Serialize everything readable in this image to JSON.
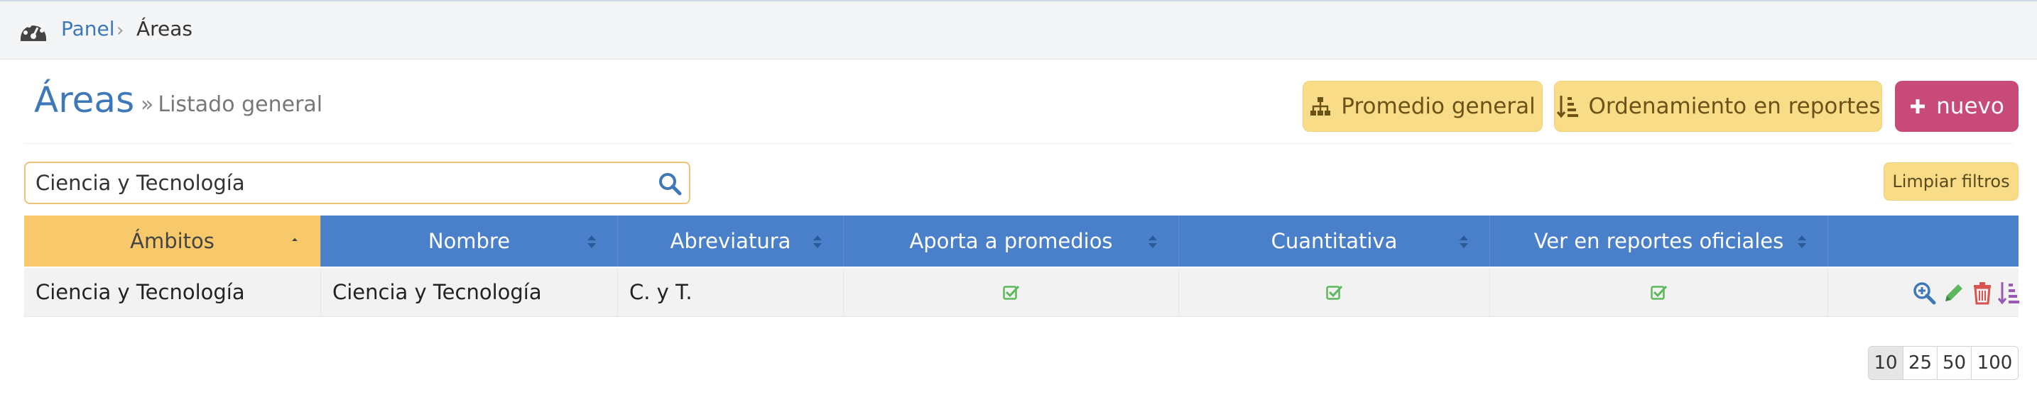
{
  "breadcrumb": {
    "root_label": "Panel",
    "separator": "›",
    "current": "Áreas"
  },
  "page": {
    "title": "Áreas",
    "subtitle_prefix": "»",
    "subtitle": "Listado general"
  },
  "toolbar": {
    "average_label": "Promedio general",
    "ordering_label": "Ordenamiento en reportes",
    "new_label": "nuevo"
  },
  "search": {
    "value": "Ciencia y Tecnología",
    "placeholder": ""
  },
  "filters": {
    "clear_label": "Limpiar filtros"
  },
  "table": {
    "columns": [
      "Ámbitos",
      "Nombre",
      "Abreviatura",
      "Aporta a promedios",
      "Cuantitativa",
      "Ver en reportes oficiales"
    ],
    "rows": [
      {
        "ambito": "Ciencia y Tecnología",
        "nombre": "Ciencia y Tecnología",
        "abreviatura": "C. y T.",
        "aporta": true,
        "cuantitativa": true,
        "ver_reportes": true
      }
    ]
  },
  "pagination": {
    "sizes": [
      "10",
      "25",
      "50",
      "100"
    ],
    "selected": "10"
  },
  "colors": {
    "primary": "#4a7fca",
    "warning": "#f8dc87",
    "danger": "#c84a78",
    "success": "#5cb85c"
  }
}
